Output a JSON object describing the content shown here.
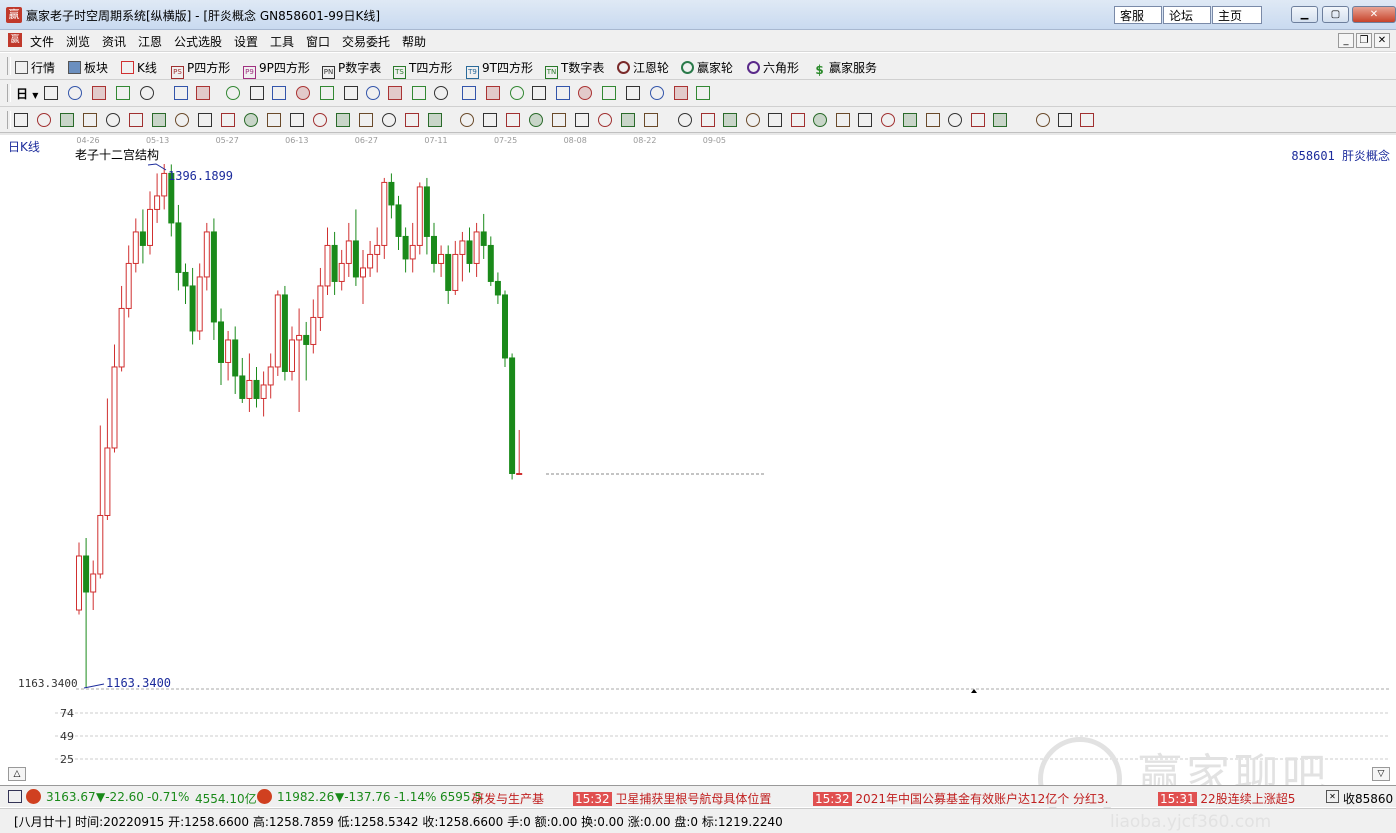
{
  "window": {
    "title": "赢家老子时空周期系统[纵横版] - [肝炎概念  GN858601-99日K线]",
    "app_icon": "赢",
    "links": [
      "客服",
      "论坛",
      "主页"
    ],
    "controls": [
      "minimize",
      "maximize",
      "close"
    ]
  },
  "menu": {
    "icon": "赢",
    "items": [
      "文件",
      "浏览",
      "资讯",
      "江恩",
      "公式选股",
      "设置",
      "工具",
      "窗口",
      "交易委托",
      "帮助"
    ]
  },
  "toolbar1": {
    "items": [
      {
        "label": "行情",
        "icon": "grid-icon"
      },
      {
        "label": "板块",
        "icon": "blocks-icon"
      },
      {
        "label": "K线",
        "icon": "candle-icon"
      },
      {
        "label": "P四方形",
        "icon": "ps-icon",
        "badge": "PS"
      },
      {
        "label": "9P四方形",
        "icon": "p9-icon",
        "badge": "P9"
      },
      {
        "label": "P数字表",
        "icon": "pn-icon",
        "badge": "PN"
      },
      {
        "label": "T四方形",
        "icon": "ts-icon",
        "badge": "TS"
      },
      {
        "label": "9T四方形",
        "icon": "t9-icon",
        "badge": "T9"
      },
      {
        "label": "T数字表",
        "icon": "tn-icon",
        "badge": "TN"
      },
      {
        "label": "江恩轮",
        "icon": "gann-wheel-icon"
      },
      {
        "label": "赢家轮",
        "icon": "winner-wheel-icon"
      },
      {
        "label": "六角形",
        "icon": "hexagon-icon"
      },
      {
        "label": "赢家服务",
        "icon": "dollar-icon"
      }
    ]
  },
  "toolbar2": {
    "period_label": "日"
  },
  "chart": {
    "period_label": "日K线",
    "indicator_name": "老子十二宫结构",
    "symbol_info": "858601  肝炎概念",
    "high_label": "1396.1899",
    "low_label": "1163.3400",
    "axis_low_label": "1163.3400",
    "date_ticks": [
      "04-26",
      "05-13",
      "05-27",
      "06-13",
      "06-27",
      "07-11",
      "07-25",
      "08-08",
      "08-22",
      "09-05"
    ],
    "lower_axis": [
      "74",
      "49",
      "25"
    ]
  },
  "chart_data": {
    "type": "candlestick",
    "title": "老子十二宫结构",
    "symbol": "858601 肝炎概念",
    "period": "日K线",
    "x_ticks": [
      "04-26",
      "05-13",
      "05-27",
      "06-13",
      "06-27",
      "07-11",
      "07-25",
      "08-08",
      "08-22",
      "09-05"
    ],
    "ylim": [
      1163.34,
      1396.1899
    ],
    "annotations": [
      {
        "label": "1396.1899",
        "type": "high"
      },
      {
        "label": "1163.3400",
        "type": "low"
      }
    ],
    "last_close": 1258.66,
    "candles": [
      [
        1198,
        1222,
        1196,
        1228
      ],
      [
        1222,
        1206,
        1163.34,
        1230
      ],
      [
        1206,
        1214,
        1198,
        1220
      ],
      [
        1214,
        1240,
        1212,
        1280
      ],
      [
        1240,
        1270,
        1238,
        1292
      ],
      [
        1270,
        1306,
        1268,
        1316
      ],
      [
        1306,
        1332,
        1304,
        1342
      ],
      [
        1332,
        1352,
        1328,
        1360
      ],
      [
        1352,
        1366,
        1348,
        1372
      ],
      [
        1366,
        1360,
        1352,
        1376
      ],
      [
        1360,
        1376,
        1356,
        1384
      ],
      [
        1376,
        1382,
        1370,
        1392
      ],
      [
        1382,
        1392,
        1376,
        1396.1899
      ],
      [
        1392,
        1370,
        1364,
        1396
      ],
      [
        1370,
        1348,
        1340,
        1378
      ],
      [
        1348,
        1342,
        1334,
        1352
      ],
      [
        1342,
        1322,
        1316,
        1350
      ],
      [
        1322,
        1346,
        1318,
        1352
      ],
      [
        1346,
        1366,
        1340,
        1370
      ],
      [
        1366,
        1326,
        1318,
        1372
      ],
      [
        1326,
        1308,
        1298,
        1332
      ],
      [
        1308,
        1318,
        1300,
        1322
      ],
      [
        1318,
        1302,
        1294,
        1324
      ],
      [
        1302,
        1292,
        1290,
        1310
      ],
      [
        1292,
        1300,
        1286,
        1312
      ],
      [
        1300,
        1292,
        1288,
        1306
      ],
      [
        1292,
        1298,
        1284,
        1304
      ],
      [
        1298,
        1306,
        1292,
        1312
      ],
      [
        1306,
        1338,
        1302,
        1340
      ],
      [
        1338,
        1304,
        1300,
        1342
      ],
      [
        1304,
        1318,
        1300,
        1324
      ],
      [
        1318,
        1320,
        1286,
        1332
      ],
      [
        1320,
        1316,
        1300,
        1326
      ],
      [
        1316,
        1328,
        1312,
        1336
      ],
      [
        1328,
        1342,
        1322,
        1350
      ],
      [
        1342,
        1360,
        1338,
        1368
      ],
      [
        1360,
        1344,
        1338,
        1366
      ],
      [
        1344,
        1352,
        1340,
        1358
      ],
      [
        1352,
        1362,
        1346,
        1370
      ],
      [
        1362,
        1346,
        1342,
        1376
      ],
      [
        1346,
        1350,
        1334,
        1358
      ],
      [
        1350,
        1356,
        1346,
        1362
      ],
      [
        1356,
        1360,
        1348,
        1368
      ],
      [
        1360,
        1388,
        1354,
        1390
      ],
      [
        1388,
        1378,
        1372,
        1392
      ],
      [
        1378,
        1364,
        1358,
        1382
      ],
      [
        1364,
        1354,
        1348,
        1368
      ],
      [
        1354,
        1360,
        1348,
        1370
      ],
      [
        1360,
        1386,
        1356,
        1388
      ],
      [
        1386,
        1364,
        1356,
        1390
      ],
      [
        1364,
        1352,
        1348,
        1370
      ],
      [
        1352,
        1356,
        1346,
        1360
      ],
      [
        1356,
        1340,
        1334,
        1360
      ],
      [
        1340,
        1356,
        1338,
        1362
      ],
      [
        1356,
        1362,
        1344,
        1366
      ],
      [
        1362,
        1352,
        1348,
        1368
      ],
      [
        1352,
        1366,
        1346,
        1370
      ],
      [
        1366,
        1360,
        1354,
        1374
      ],
      [
        1360,
        1344,
        1342,
        1364
      ],
      [
        1344,
        1338,
        1334,
        1348
      ],
      [
        1338,
        1310,
        1306,
        1340
      ],
      [
        1310,
        1258.66,
        1256,
        1312
      ],
      [
        1258.66,
        1258.66,
        1258.5342,
        1278
      ]
    ]
  },
  "status": {
    "index1_value": "3163.67",
    "index1_change": "▼-22.60",
    "index1_pct": "-0.71%",
    "index1_amount": "4554.10亿",
    "index2_value": "11982.26",
    "index2_change": "▼-137.76",
    "index2_pct": "-1.14%",
    "index2_amount": "6595.5",
    "news": [
      {
        "time": "",
        "text": "研发与生产基"
      },
      {
        "time": "15:32",
        "text": "卫星捕获里根号航母具体位置"
      },
      {
        "time": "15:32",
        "text": "2021年中国公募基金有效账户达12亿个 分红3."
      },
      {
        "time": "15:31",
        "text": "22股连续上涨超5"
      }
    ],
    "right_label": "收85860"
  },
  "info": {
    "text": "[八月廿十] 时间:20220915 开:1258.6600 高:1258.7859 低:1258.5342 收:1258.6600 手:0 额:0.00 换:0.00 涨:0.00 盘:0 标:1219.2240"
  },
  "watermark": {
    "text": "赢家聊吧",
    "url": "liaoba.yjcf360.com"
  },
  "colors": {
    "up": "#d03030",
    "down": "#1a8a1a",
    "accent": "#1c2c9c"
  }
}
